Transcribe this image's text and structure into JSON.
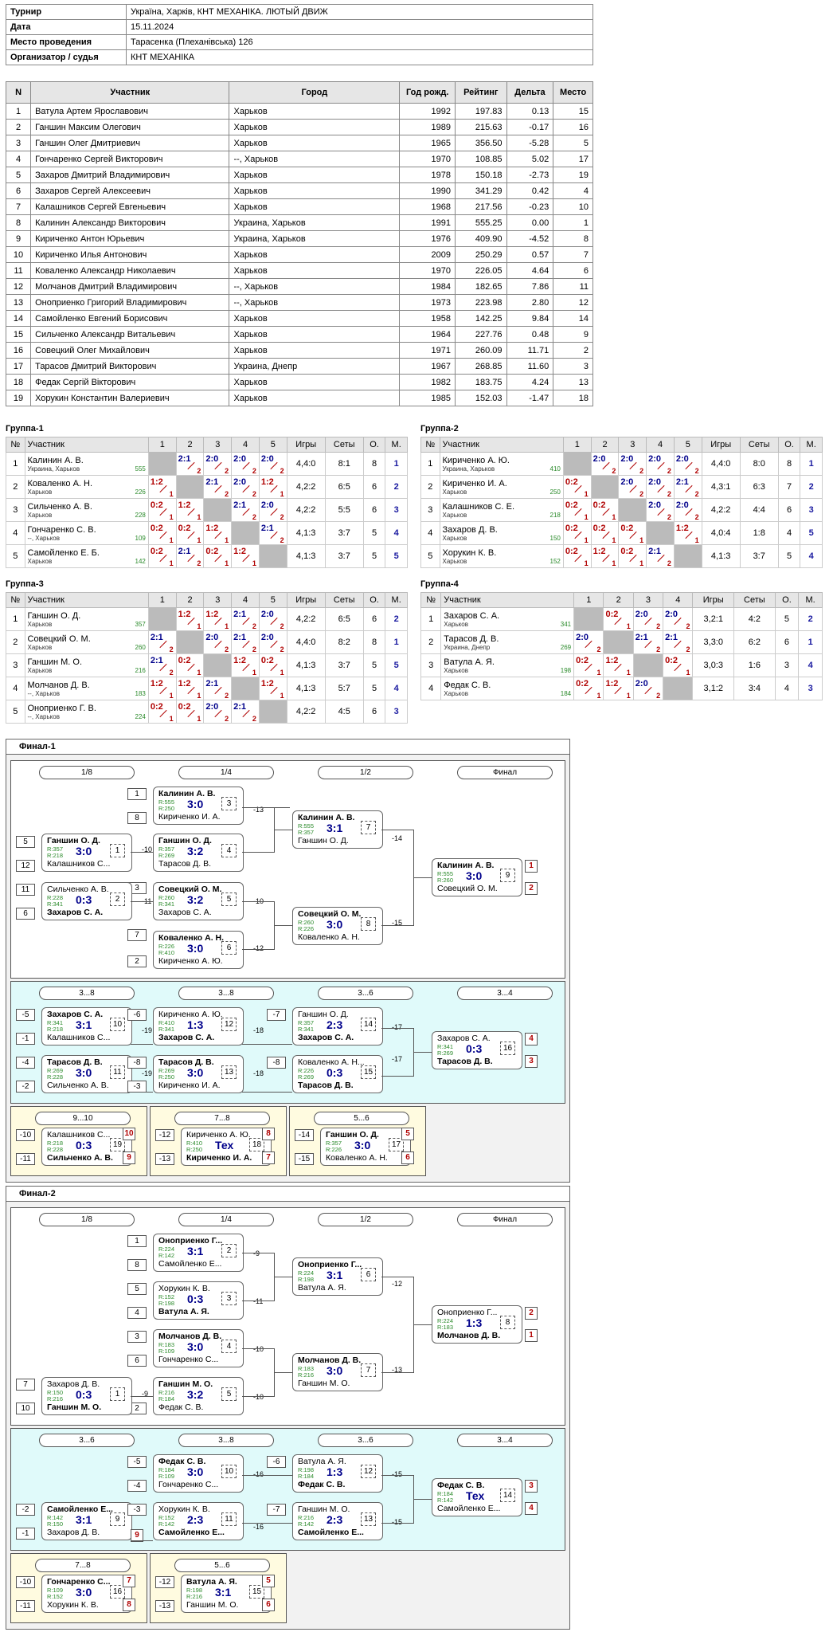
{
  "info": [
    {
      "k": "Турнир",
      "v": "Україна, Харків, КНТ МЕХАНІКА. ЛЮТЫЙ ДВИЖ"
    },
    {
      "k": "Дата",
      "v": "15.11.2024"
    },
    {
      "k": "Место проведения",
      "v": "Тарасенка (Плеханівська) 126"
    },
    {
      "k": "Организатор / судья",
      "v": "КНТ МЕХАНІКА"
    }
  ],
  "participants_header": [
    "N",
    "Участник",
    "Город",
    "Год рожд.",
    "Рейтинг",
    "Дельта",
    "Место"
  ],
  "participants": [
    [
      "1",
      "Ватула Артем Ярославович",
      "Харьков",
      "1992",
      "197.83",
      "0.13",
      "15"
    ],
    [
      "2",
      "Ганшин Максим Олегович",
      "Харьков",
      "1989",
      "215.63",
      "-0.17",
      "16"
    ],
    [
      "3",
      "Ганшин Олег Дмитриевич",
      "Харьков",
      "1965",
      "356.50",
      "-5.28",
      "5"
    ],
    [
      "4",
      "Гончаренко Сергей Викторович",
      "--, Харьков",
      "1970",
      "108.85",
      "5.02",
      "17"
    ],
    [
      "5",
      "Захаров Дмитрий Владимирович",
      "Харьков",
      "1978",
      "150.18",
      "-2.73",
      "19"
    ],
    [
      "6",
      "Захаров Сергей Алексеевич",
      "Харьков",
      "1990",
      "341.29",
      "0.42",
      "4"
    ],
    [
      "7",
      "Калашников Сергей Евгеньевич",
      "Харьков",
      "1968",
      "217.56",
      "-0.23",
      "10"
    ],
    [
      "8",
      "Калинин Александр Викторович",
      "Украина, Харьков",
      "1991",
      "555.25",
      "0.00",
      "1"
    ],
    [
      "9",
      "Кириченко Антон Юрьевич",
      "Украина, Харьков",
      "1976",
      "409.90",
      "-4.52",
      "8"
    ],
    [
      "10",
      "Кириченко Илья Антонович",
      "Харьков",
      "2009",
      "250.29",
      "0.57",
      "7"
    ],
    [
      "11",
      "Коваленко Александр Николаевич",
      "Харьков",
      "1970",
      "226.05",
      "4.64",
      "6"
    ],
    [
      "12",
      "Молчанов Дмитрий Владимирович",
      "--, Харьков",
      "1984",
      "182.65",
      "7.86",
      "11"
    ],
    [
      "13",
      "Оноприенко Григорий Владимирович",
      "--, Харьков",
      "1973",
      "223.98",
      "2.80",
      "12"
    ],
    [
      "14",
      "Самойленко Евгений Борисович",
      "Харьков",
      "1958",
      "142.25",
      "9.84",
      "14"
    ],
    [
      "15",
      "Сильченко Александр Витальевич",
      "Харьков",
      "1964",
      "227.76",
      "0.48",
      "9"
    ],
    [
      "16",
      "Совецкий Олег Михайлович",
      "Харьков",
      "1971",
      "260.09",
      "11.71",
      "2"
    ],
    [
      "17",
      "Тарасов Дмитрий Викторович",
      "Украина, Днепр",
      "1967",
      "268.85",
      "11.60",
      "3"
    ],
    [
      "18",
      "Федак Сергій Вікторович",
      "Харьков",
      "1982",
      "183.75",
      "4.24",
      "13"
    ],
    [
      "19",
      "Хорукин Константин Валериевич",
      "Харьков",
      "1985",
      "152.03",
      "-1.47",
      "18"
    ]
  ],
  "group_header": [
    "№",
    "Участник",
    "1",
    "2",
    "3",
    "4",
    "5",
    "Игры",
    "Сеты",
    "О.",
    "М."
  ],
  "group_header4": [
    "№",
    "Участник",
    "1",
    "2",
    "3",
    "4",
    "Игры",
    "Сеты",
    "О.",
    "М."
  ],
  "groups": [
    {
      "title": "Группа-1",
      "rows": [
        {
          "n": "1",
          "name": "Калинин А. В.",
          "city": "Украина, Харьков",
          "rat": "555",
          "s": [
            "",
            "2:1",
            "2:0",
            "2:0",
            "2:0"
          ],
          "games": "4,4:0",
          "sets": "8:1",
          "o": "8",
          "m": "1"
        },
        {
          "n": "2",
          "name": "Коваленко А. Н.",
          "city": "Харьков",
          "rat": "226",
          "s": [
            "1:2",
            "",
            "2:1",
            "2:0",
            "1:2"
          ],
          "games": "4,2:2",
          "sets": "6:5",
          "o": "6",
          "m": "2"
        },
        {
          "n": "3",
          "name": "Сильченко А. В.",
          "city": "Харьков",
          "rat": "228",
          "s": [
            "0:2",
            "1:2",
            "",
            "2:1",
            "2:0"
          ],
          "games": "4,2:2",
          "sets": "5:5",
          "o": "6",
          "m": "3"
        },
        {
          "n": "4",
          "name": "Гончаренко С. В.",
          "city": "--, Харьков",
          "rat": "109",
          "s": [
            "0:2",
            "0:2",
            "1:2",
            "",
            "2:1"
          ],
          "games": "4,1:3",
          "sets": "3:7",
          "o": "5",
          "m": "4"
        },
        {
          "n": "5",
          "name": "Самойленко Е. Б.",
          "city": "Харьков",
          "rat": "142",
          "s": [
            "0:2",
            "2:1",
            "0:2",
            "1:2",
            ""
          ],
          "games": "4,1:3",
          "sets": "3:7",
          "o": "5",
          "m": "5"
        }
      ]
    },
    {
      "title": "Группа-2",
      "rows": [
        {
          "n": "1",
          "name": "Кириченко А. Ю.",
          "city": "Украина, Харьков",
          "rat": "410",
          "s": [
            "",
            "2:0",
            "2:0",
            "2:0",
            "2:0"
          ],
          "games": "4,4:0",
          "sets": "8:0",
          "o": "8",
          "m": "1"
        },
        {
          "n": "2",
          "name": "Кириченко И. А.",
          "city": "Харьков",
          "rat": "250",
          "s": [
            "0:2",
            "",
            "2:0",
            "2:0",
            "2:1"
          ],
          "games": "4,3:1",
          "sets": "6:3",
          "o": "7",
          "m": "2"
        },
        {
          "n": "3",
          "name": "Калашников С. Е.",
          "city": "Харьков",
          "rat": "218",
          "s": [
            "0:2",
            "0:2",
            "",
            "2:0",
            "2:0"
          ],
          "games": "4,2:2",
          "sets": "4:4",
          "o": "6",
          "m": "3"
        },
        {
          "n": "4",
          "name": "Захаров Д. В.",
          "city": "Харьков",
          "rat": "150",
          "s": [
            "0:2",
            "0:2",
            "0:2",
            "",
            "1:2"
          ],
          "games": "4,0:4",
          "sets": "1:8",
          "o": "4",
          "m": "5"
        },
        {
          "n": "5",
          "name": "Хорукин К. В.",
          "city": "Харьков",
          "rat": "152",
          "s": [
            "0:2",
            "1:2",
            "0:2",
            "2:1",
            ""
          ],
          "games": "4,1:3",
          "sets": "3:7",
          "o": "5",
          "m": "4"
        }
      ]
    },
    {
      "title": "Группа-3",
      "rows": [
        {
          "n": "1",
          "name": "Ганшин О. Д.",
          "city": "Харьков",
          "rat": "357",
          "s": [
            "",
            "1:2",
            "1:2",
            "2:1",
            "2:0"
          ],
          "games": "4,2:2",
          "sets": "6:5",
          "o": "6",
          "m": "2"
        },
        {
          "n": "2",
          "name": "Совецкий О. М.",
          "city": "Харьков",
          "rat": "260",
          "s": [
            "2:1",
            "",
            "2:0",
            "2:1",
            "2:0"
          ],
          "games": "4,4:0",
          "sets": "8:2",
          "o": "8",
          "m": "1"
        },
        {
          "n": "3",
          "name": "Ганшин М. О.",
          "city": "Харьков",
          "rat": "216",
          "s": [
            "2:1",
            "0:2",
            "",
            "1:2",
            "0:2"
          ],
          "games": "4,1:3",
          "sets": "3:7",
          "o": "5",
          "m": "5"
        },
        {
          "n": "4",
          "name": "Молчанов Д. В.",
          "city": "--, Харьков",
          "rat": "183",
          "s": [
            "1:2",
            "1:2",
            "2:1",
            "",
            "1:2"
          ],
          "games": "4,1:3",
          "sets": "5:7",
          "o": "5",
          "m": "4"
        },
        {
          "n": "5",
          "name": "Оноприенко Г. В.",
          "city": "--, Харьков",
          "rat": "224",
          "s": [
            "0:2",
            "0:2",
            "2:0",
            "2:1",
            ""
          ],
          "games": "4,2:2",
          "sets": "4:5",
          "o": "6",
          "m": "3"
        }
      ]
    },
    {
      "title": "Группа-4",
      "rows": [
        {
          "n": "1",
          "name": "Захаров С. А.",
          "city": "Харьков",
          "rat": "341",
          "s": [
            "",
            "0:2",
            "2:0",
            "2:0"
          ],
          "games": "3,2:1",
          "sets": "4:2",
          "o": "5",
          "m": "2"
        },
        {
          "n": "2",
          "name": "Тарасов Д. В.",
          "city": "Украина, Днепр",
          "rat": "269",
          "s": [
            "2:0",
            "",
            "2:1",
            "2:1"
          ],
          "games": "3,3:0",
          "sets": "6:2",
          "o": "6",
          "m": "1"
        },
        {
          "n": "3",
          "name": "Ватула А. Я.",
          "city": "Харьков",
          "rat": "198",
          "s": [
            "0:2",
            "1:2",
            "",
            "0:2"
          ],
          "games": "3,0:3",
          "sets": "1:6",
          "o": "3",
          "m": "4"
        },
        {
          "n": "4",
          "name": "Федак С. В.",
          "city": "Харьков",
          "rat": "184",
          "s": [
            "0:2",
            "1:2",
            "2:0",
            ""
          ],
          "games": "3,1:2",
          "sets": "3:4",
          "o": "4",
          "m": "3"
        }
      ]
    }
  ],
  "final1": {
    "title": "Финал-1",
    "rounds": [
      "1/8",
      "1/4",
      "1/2",
      "Финал"
    ],
    "rounds2": [
      "3...8",
      "3...8",
      "3...6",
      "3...4"
    ],
    "rounds3": [
      "9...10",
      "7...8",
      "5...6"
    ],
    "m1": {
      "a": "Ганшин О. Д.",
      "ra": "R:357",
      "b": "Калашников С...",
      "rb": "R:218",
      "res": "3:0",
      "id": "1"
    },
    "m2": {
      "a": "Сильченко А. В.",
      "ra": "R:228",
      "b": "Захаров С. А.",
      "rb": "R:341",
      "res": "0:3",
      "id": "2"
    },
    "m3": {
      "a": "Калинин А. В.",
      "ra": "R:555",
      "b": "Кириченко И. А.",
      "rb": "R:250",
      "res": "3:0",
      "id": "3"
    },
    "m4": {
      "a": "Ганшин О. Д.",
      "ra": "R:357",
      "b": "Тарасов Д. В.",
      "rb": "R:269",
      "res": "3:2",
      "id": "4"
    },
    "m5": {
      "a": "Совецкий О. М.",
      "ra": "R:260",
      "b": "Захаров С. А.",
      "rb": "R:341",
      "res": "3:2",
      "id": "5"
    },
    "m6": {
      "a": "Коваленко А. Н.",
      "ra": "R:226",
      "b": "Кириченко А. Ю.",
      "rb": "R:410",
      "res": "3:0",
      "id": "6"
    },
    "m7": {
      "a": "Калинин А. В.",
      "ra": "R:555",
      "b": "Ганшин О. Д.",
      "rb": "R:357",
      "res": "3:1",
      "id": "7"
    },
    "m8": {
      "a": "Совецкий О. М.",
      "ra": "R:260",
      "b": "Коваленко А. Н.",
      "rb": "R:226",
      "res": "3:0",
      "id": "8"
    },
    "m9": {
      "a": "Калинин А. В.",
      "ra": "R:555",
      "b": "Совецкий О. М.",
      "rb": "R:260",
      "res": "3:0",
      "id": "9"
    },
    "m10": {
      "a": "Захаров С. А.",
      "ra": "R:341",
      "b": "Калашников С...",
      "rb": "R:218",
      "res": "3:1",
      "id": "10"
    },
    "m11": {
      "a": "Тарасов Д. В.",
      "ra": "R:269",
      "b": "Сильченко А. В.",
      "rb": "R:228",
      "res": "3:0",
      "id": "11"
    },
    "m12": {
      "a": "Кириченко А. Ю.",
      "ra": "R:410",
      "b": "Захаров С. А.",
      "rb": "R:341",
      "res": "1:3",
      "id": "12"
    },
    "m13": {
      "a": "Тарасов Д. В.",
      "ra": "R:269",
      "b": "Кириченко И. А.",
      "rb": "R:250",
      "res": "3:0",
      "id": "13"
    },
    "m14": {
      "a": "Ганшин О. Д.",
      "ra": "R:357",
      "b": "Захаров С. А.",
      "rb": "R:341",
      "res": "2:3",
      "id": "14"
    },
    "m15": {
      "a": "Коваленко А. Н...",
      "ra": "R:226",
      "b": "Тарасов Д. В.",
      "rb": "R:269",
      "res": "0:3",
      "id": "15"
    },
    "m16": {
      "a": "Захаров С. А.",
      "ra": "R:341",
      "b": "Тарасов Д. В.",
      "rb": "R:269",
      "res": "0:3",
      "id": "16"
    },
    "m19": {
      "a": "Калашников С...",
      "ra": "R:218",
      "b": "Сильченко А. В.",
      "rb": "R:228",
      "res": "0:3",
      "id": "19"
    },
    "m18": {
      "a": "Кириченко А. Ю.",
      "ra": "R:410",
      "b": "Кириченко И. А.",
      "rb": "R:250",
      "res": "Тех",
      "id": "18"
    },
    "m17": {
      "a": "Ганшин О. Д.",
      "ra": "R:357",
      "b": "Коваленко А. Н.",
      "rb": "R:226",
      "res": "3:0",
      "id": "17"
    }
  },
  "final2": {
    "title": "Финал-2",
    "rounds": [
      "1/8",
      "1/4",
      "1/2",
      "Финал"
    ],
    "rounds2": [
      "3...6",
      "3...8",
      "3...6",
      "3...4"
    ],
    "rounds3": [
      "7...8",
      "5...6"
    ],
    "m1": {
      "a": "Захаров Д. В.",
      "ra": "R:150",
      "b": "Ганшин М. О.",
      "rb": "R:216",
      "res": "0:3",
      "id": "1"
    },
    "m2": {
      "a": "Оноприенко Г...",
      "ra": "R:224",
      "b": "Самойленко Е...",
      "rb": "R:142",
      "res": "3:1",
      "id": "2"
    },
    "m3": {
      "a": "Хорукин К. В.",
      "ra": "R:152",
      "b": "Ватула А. Я.",
      "rb": "R:198",
      "res": "0:3",
      "id": "3"
    },
    "m4": {
      "a": "Молчанов Д. В.",
      "ra": "R:183",
      "b": "Гончаренко С...",
      "rb": "R:109",
      "res": "3:0",
      "id": "4"
    },
    "m5": {
      "a": "Ганшин М. О.",
      "ra": "R:216",
      "b": "Федак С. В.",
      "rb": "R:184",
      "res": "3:2",
      "id": "5"
    },
    "m6": {
      "a": "Оноприенко Г...",
      "ra": "R:224",
      "b": "Ватула А. Я.",
      "rb": "R:198",
      "res": "3:1",
      "id": "6"
    },
    "m7": {
      "a": "Молчанов Д. В.",
      "ra": "R:183",
      "b": "Ганшин М. О.",
      "rb": "R:216",
      "res": "3:0",
      "id": "7"
    },
    "m8": {
      "a": "Оноприенко Г...",
      "ra": "R:224",
      "b": "Молчанов Д. В.",
      "rb": "R:183",
      "res": "1:3",
      "id": "8"
    },
    "m9": {
      "a": "Самойленко Е...",
      "ra": "R:142",
      "b": "Захаров Д. В.",
      "rb": "R:150",
      "res": "3:1",
      "id": "9"
    },
    "m10": {
      "a": "Федак С. В.",
      "ra": "R:184",
      "b": "Гончаренко С...",
      "rb": "R:109",
      "res": "3:0",
      "id": "10"
    },
    "m11": {
      "a": "Хорукин К. В.",
      "ra": "R:152",
      "b": "Самойленко Е...",
      "rb": "R:142",
      "res": "2:3",
      "id": "11"
    },
    "m12": {
      "a": "Ватула А. Я.",
      "ra": "R:198",
      "b": "Федак С. В.",
      "rb": "R:184",
      "res": "1:3",
      "id": "12"
    },
    "m13": {
      "a": "Ганшин М. О.",
      "ra": "R:216",
      "b": "Самойленко Е...",
      "rb": "R:142",
      "res": "2:3",
      "id": "13"
    },
    "m14": {
      "a": "Федак С. В.",
      "ra": "R:184",
      "b": "Самойленко Е...",
      "rb": "R:142",
      "res": "Тех",
      "id": "14"
    },
    "m16": {
      "a": "Гончаренко С...",
      "ra": "R:109",
      "b": "Хорукин К. В.",
      "rb": "R:152",
      "res": "3:0",
      "id": "16"
    },
    "m15": {
      "a": "Ватула А. Я.",
      "ra": "R:198",
      "b": "Ганшин М. О.",
      "rb": "R:216",
      "res": "3:1",
      "id": "15"
    }
  },
  "colors": {
    "win": "#00008b",
    "lose": "#b00000",
    "rating": "#2a8a2a",
    "panel2": "#e0fafa",
    "panel3": "#fffbe0"
  }
}
